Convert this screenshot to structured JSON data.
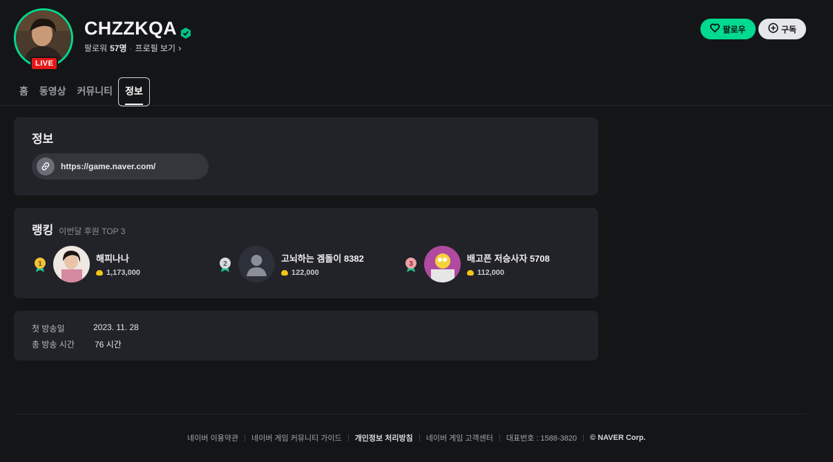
{
  "channel": {
    "name": "CHZZKQA",
    "live_badge": "LIVE",
    "follower_label": "팔로워",
    "follower_count": "57명",
    "separator": "·",
    "profile_link": "프로필 보기",
    "verified_icon": "verified-badge-icon"
  },
  "actions": {
    "follow_label": "팔로우",
    "subscribe_label": "구독",
    "accent_color": "#00d98f"
  },
  "tabs": [
    {
      "label": "홈"
    },
    {
      "label": "동영상"
    },
    {
      "label": "커뮤니티"
    },
    {
      "label": "정보",
      "active": true
    }
  ],
  "info": {
    "title": "정보",
    "link_url": "https://game.naver.com/",
    "link_icon": "link-icon"
  },
  "ranking": {
    "title": "랭킹",
    "subtitle": "이번달 후원 TOP 3",
    "items": [
      {
        "rank": "1",
        "name": "해피나나",
        "amount": "1,173,000"
      },
      {
        "rank": "2",
        "name": "고뇌하는 겜돌이 8382",
        "amount": "122,000"
      },
      {
        "rank": "3",
        "name": "배고픈 저승사자 5708",
        "amount": "112,000"
      }
    ]
  },
  "stats": {
    "first_broadcast_label": "첫 방송일",
    "first_broadcast_value": "2023. 11. 28",
    "total_time_label": "총 방송 시간",
    "total_time_value": "76 시간"
  },
  "footer": {
    "links": [
      "네이버 이용약관",
      "네이버 게임 커뮤니티 가이드",
      "개인정보 처리방침",
      "네이버 게임 고객센터"
    ],
    "phone": "대표번호 : 1588-3820",
    "copyright": "© NAVER Corp."
  }
}
